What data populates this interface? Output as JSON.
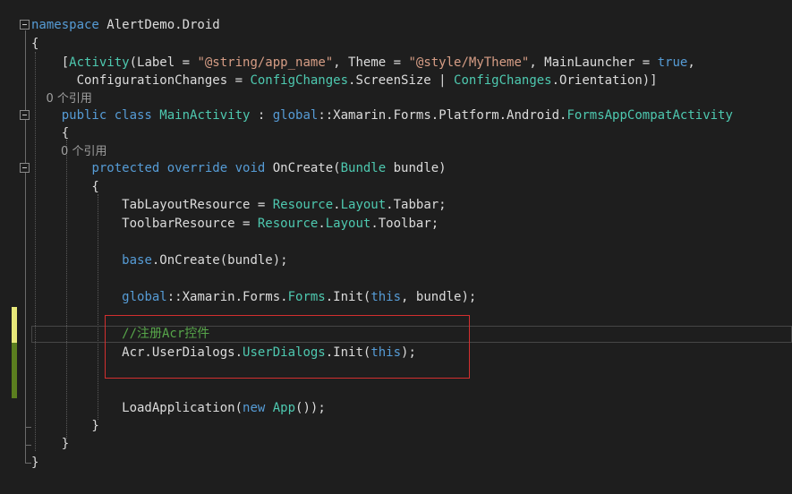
{
  "code": {
    "l1": [
      {
        "t": "namespace",
        "c": "kw"
      },
      {
        "t": " AlertDemo.Droid",
        "c": "pl"
      }
    ],
    "l2": [
      {
        "t": "{",
        "c": "pl"
      }
    ],
    "l3": [
      {
        "t": "    [",
        "c": "pl"
      },
      {
        "t": "Activity",
        "c": "type"
      },
      {
        "t": "(Label = ",
        "c": "pl"
      },
      {
        "t": "\"@string/app_name\"",
        "c": "str"
      },
      {
        "t": ", Theme = ",
        "c": "pl"
      },
      {
        "t": "\"@style/MyTheme\"",
        "c": "str"
      },
      {
        "t": ", MainLauncher = ",
        "c": "pl"
      },
      {
        "t": "true",
        "c": "kw"
      },
      {
        "t": ",",
        "c": "pl"
      }
    ],
    "l4": [
      {
        "t": "      ConfigurationChanges = ",
        "c": "pl"
      },
      {
        "t": "ConfigChanges",
        "c": "type"
      },
      {
        "t": ".ScreenSize | ",
        "c": "pl"
      },
      {
        "t": "ConfigChanges",
        "c": "type"
      },
      {
        "t": ".Orientation)]",
        "c": "pl"
      }
    ],
    "l5": [
      {
        "t": "    0 个引用",
        "c": "ref"
      }
    ],
    "l6": [
      {
        "t": "    ",
        "c": "pl"
      },
      {
        "t": "public class ",
        "c": "kw"
      },
      {
        "t": "MainActivity",
        "c": "type"
      },
      {
        "t": " : ",
        "c": "pl"
      },
      {
        "t": "global",
        "c": "kw"
      },
      {
        "t": "::Xamarin.Forms.Platform.Android.",
        "c": "pl"
      },
      {
        "t": "FormsAppCompatActivity",
        "c": "type"
      }
    ],
    "l7": [
      {
        "t": "    {",
        "c": "pl"
      }
    ],
    "l8": [
      {
        "t": "        0 个引用",
        "c": "ref"
      }
    ],
    "l9": [
      {
        "t": "        ",
        "c": "pl"
      },
      {
        "t": "protected override void ",
        "c": "kw"
      },
      {
        "t": "OnCreate(",
        "c": "pl"
      },
      {
        "t": "Bundle",
        "c": "type"
      },
      {
        "t": " bundle)",
        "c": "pl"
      }
    ],
    "l10": [
      {
        "t": "        {",
        "c": "pl"
      }
    ],
    "l11": [
      {
        "t": "            TabLayoutResource = ",
        "c": "pl"
      },
      {
        "t": "Resource",
        "c": "type"
      },
      {
        "t": ".",
        "c": "pl"
      },
      {
        "t": "Layout",
        "c": "type"
      },
      {
        "t": ".Tabbar;",
        "c": "pl"
      }
    ],
    "l12": [
      {
        "t": "            ToolbarResource = ",
        "c": "pl"
      },
      {
        "t": "Resource",
        "c": "type"
      },
      {
        "t": ".",
        "c": "pl"
      },
      {
        "t": "Layout",
        "c": "type"
      },
      {
        "t": ".Toolbar;",
        "c": "pl"
      }
    ],
    "l13": [
      {
        "t": "            ",
        "c": "pl"
      },
      {
        "t": "base",
        "c": "kw"
      },
      {
        "t": ".OnCreate(bundle);",
        "c": "pl"
      }
    ],
    "l14": [
      {
        "t": "            ",
        "c": "pl"
      },
      {
        "t": "global",
        "c": "kw"
      },
      {
        "t": "::Xamarin.Forms.",
        "c": "pl"
      },
      {
        "t": "Forms",
        "c": "type"
      },
      {
        "t": ".Init(",
        "c": "pl"
      },
      {
        "t": "this",
        "c": "kw"
      },
      {
        "t": ", bundle);",
        "c": "pl"
      }
    ],
    "l15": [
      {
        "t": "            //注册Acr控件",
        "c": "cmt"
      }
    ],
    "l16": [
      {
        "t": "            Acr.UserDialogs.",
        "c": "pl"
      },
      {
        "t": "UserDialogs",
        "c": "type"
      },
      {
        "t": ".Init(",
        "c": "pl"
      },
      {
        "t": "this",
        "c": "kw"
      },
      {
        "t": ");",
        "c": "pl"
      }
    ],
    "l17": [
      {
        "t": "            LoadApplication(",
        "c": "pl"
      },
      {
        "t": "new ",
        "c": "kw"
      },
      {
        "t": "App",
        "c": "type"
      },
      {
        "t": "());",
        "c": "pl"
      }
    ],
    "l18": [
      {
        "t": "        }",
        "c": "pl"
      }
    ],
    "l19": [
      {
        "t": "    }",
        "c": "pl"
      }
    ],
    "l20": [
      {
        "t": "}",
        "c": "pl"
      }
    ]
  },
  "colors": {
    "background": "#1e1e1e",
    "keyword": "#569cd6",
    "type": "#4ec9b0",
    "string": "#d69d85",
    "comment": "#57a64a",
    "plain": "#dcdcdc",
    "annotation_box": "#d32f2f",
    "change_saved": "#5b7e1f",
    "change_unsaved": "#e8e87a"
  }
}
